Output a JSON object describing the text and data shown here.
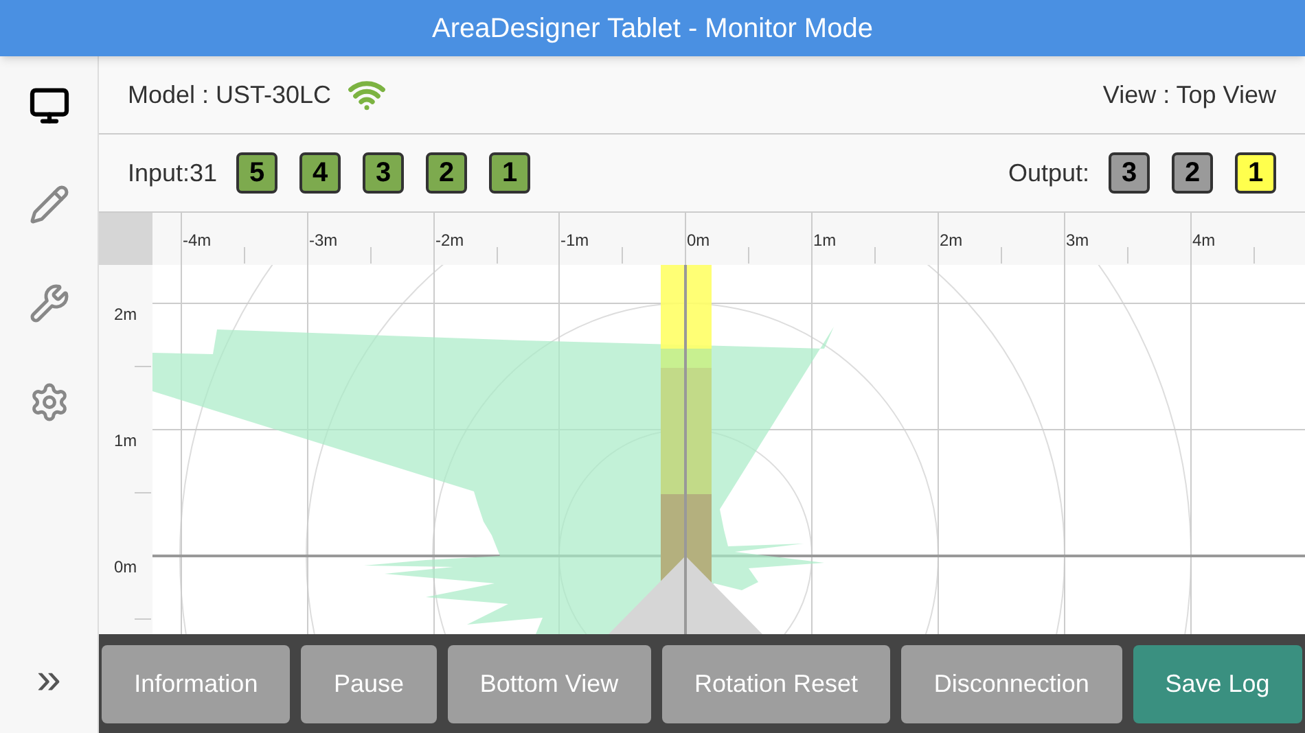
{
  "window": {
    "title": "AreaDesigner Tablet - Monitor Mode"
  },
  "sidebar": {
    "items": [
      {
        "kind": "monitor",
        "selected": true
      },
      {
        "kind": "edit",
        "selected": false
      },
      {
        "kind": "tools",
        "selected": false
      },
      {
        "kind": "settings",
        "selected": false
      }
    ],
    "expand": "»"
  },
  "header": {
    "model": "Model : UST-30LC",
    "view": "View : Top View"
  },
  "inputs": {
    "label": "Input:31",
    "items": [
      {
        "label": "5",
        "on": true
      },
      {
        "label": "4",
        "on": true
      },
      {
        "label": "3",
        "on": true
      },
      {
        "label": "2",
        "on": true
      },
      {
        "label": "1",
        "on": true
      }
    ]
  },
  "outputs": {
    "label": "Output:",
    "items": [
      {
        "label": "3",
        "on": false
      },
      {
        "label": "2",
        "on": false
      },
      {
        "label": "1",
        "on": true
      }
    ]
  },
  "ruler": {
    "x_labels": [
      "-4m",
      "-3m",
      "-2m",
      "-1m",
      "0m",
      "1m",
      "2m",
      "3m",
      "4m"
    ],
    "y_labels": [
      "2m",
      "1m",
      "0m"
    ]
  },
  "buttons": [
    {
      "label": "Information",
      "kind": "normal"
    },
    {
      "label": "Pause",
      "kind": "normal"
    },
    {
      "label": "Bottom View",
      "kind": "normal"
    },
    {
      "label": "Rotation Reset",
      "kind": "normal"
    },
    {
      "label": "Disconnection",
      "kind": "normal"
    },
    {
      "label": "Save Log",
      "kind": "primary"
    }
  ]
}
